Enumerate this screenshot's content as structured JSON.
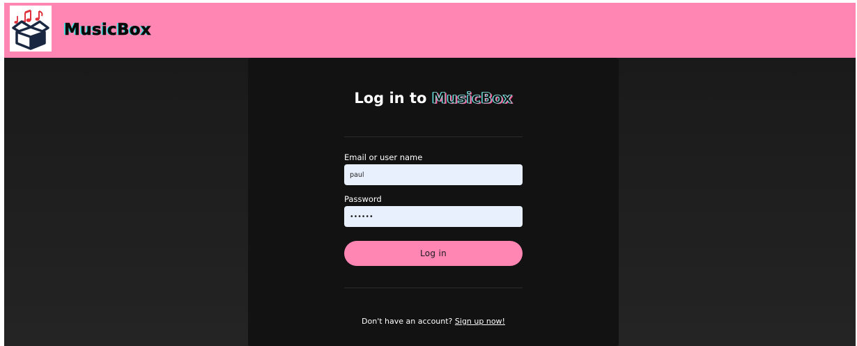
{
  "header": {
    "app_name": "MusicBox",
    "logo_icon": "music-box-logo-icon",
    "background_color": "#ff85b3"
  },
  "login": {
    "title_prefix": "Log in to",
    "title_brand": "MusicBox",
    "email_label": "Email or user name",
    "email_value": "paul",
    "password_label": "Password",
    "password_value": "paulpw",
    "submit_label": "Log in",
    "signup_prompt": "Don't have an account?",
    "signup_link": "Sign up now!"
  },
  "colors": {
    "accent": "#ff85b3",
    "card_background": "#121212",
    "page_background": "#1c1c1c",
    "input_background": "#e8f0fe"
  }
}
